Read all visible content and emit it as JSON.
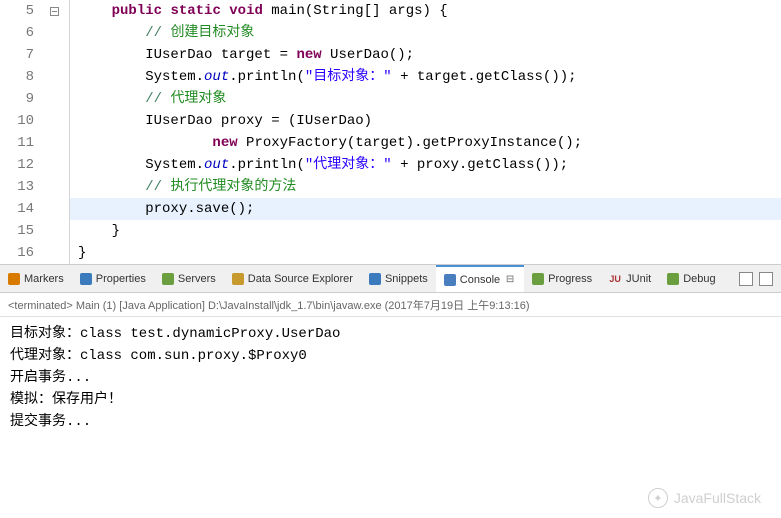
{
  "code": {
    "lines": [
      {
        "num": "5",
        "fold": true,
        "highlighted": false,
        "segments": [
          {
            "t": "    ",
            "c": "plain"
          },
          {
            "t": "public",
            "c": "kw"
          },
          {
            "t": " ",
            "c": "plain"
          },
          {
            "t": "static",
            "c": "kw"
          },
          {
            "t": " ",
            "c": "plain"
          },
          {
            "t": "void",
            "c": "kw"
          },
          {
            "t": " main(String[] args) {",
            "c": "plain"
          }
        ]
      },
      {
        "num": "6",
        "fold": false,
        "highlighted": false,
        "segments": [
          {
            "t": "        ",
            "c": "plain"
          },
          {
            "t": "// ",
            "c": "com"
          },
          {
            "t": "创建目标对象",
            "c": "com-cn"
          }
        ]
      },
      {
        "num": "7",
        "fold": false,
        "highlighted": false,
        "segments": [
          {
            "t": "        IUserDao target = ",
            "c": "plain"
          },
          {
            "t": "new",
            "c": "kw"
          },
          {
            "t": " UserDao();",
            "c": "plain"
          }
        ]
      },
      {
        "num": "8",
        "fold": false,
        "highlighted": false,
        "segments": [
          {
            "t": "        System.",
            "c": "plain"
          },
          {
            "t": "out",
            "c": "field"
          },
          {
            "t": ".println(",
            "c": "plain"
          },
          {
            "t": "\"目标对象：\"",
            "c": "str"
          },
          {
            "t": " + target.getClass());",
            "c": "plain"
          }
        ]
      },
      {
        "num": "9",
        "fold": false,
        "highlighted": false,
        "segments": [
          {
            "t": "        ",
            "c": "plain"
          },
          {
            "t": "// ",
            "c": "com"
          },
          {
            "t": "代理对象",
            "c": "com-cn"
          }
        ]
      },
      {
        "num": "10",
        "fold": false,
        "highlighted": false,
        "segments": [
          {
            "t": "        IUserDao proxy = (IUserDao)",
            "c": "plain"
          }
        ]
      },
      {
        "num": "11",
        "fold": false,
        "highlighted": false,
        "segments": [
          {
            "t": "                ",
            "c": "plain"
          },
          {
            "t": "new",
            "c": "kw"
          },
          {
            "t": " ProxyFactory(target).getProxyInstance();",
            "c": "plain"
          }
        ]
      },
      {
        "num": "12",
        "fold": false,
        "highlighted": false,
        "segments": [
          {
            "t": "        System.",
            "c": "plain"
          },
          {
            "t": "out",
            "c": "field"
          },
          {
            "t": ".println(",
            "c": "plain"
          },
          {
            "t": "\"代理对象：\"",
            "c": "str"
          },
          {
            "t": " + proxy.getClass());",
            "c": "plain"
          }
        ]
      },
      {
        "num": "13",
        "fold": false,
        "highlighted": false,
        "segments": [
          {
            "t": "        ",
            "c": "plain"
          },
          {
            "t": "// ",
            "c": "com"
          },
          {
            "t": "执行代理对象的方法",
            "c": "com-cn"
          }
        ]
      },
      {
        "num": "14",
        "fold": false,
        "highlighted": true,
        "segments": [
          {
            "t": "        proxy.save();",
            "c": "plain"
          }
        ]
      },
      {
        "num": "15",
        "fold": false,
        "highlighted": false,
        "segments": [
          {
            "t": "    }",
            "c": "plain"
          }
        ]
      },
      {
        "num": "16",
        "fold": false,
        "highlighted": false,
        "segments": [
          {
            "t": "}",
            "c": "plain"
          }
        ]
      }
    ]
  },
  "tabs": [
    {
      "id": "markers",
      "label": "Markers",
      "icon": "#d97a00"
    },
    {
      "id": "properties",
      "label": "Properties",
      "icon": "#3a7abd"
    },
    {
      "id": "servers",
      "label": "Servers",
      "icon": "#6a9e3f"
    },
    {
      "id": "dse",
      "label": "Data Source Explorer",
      "icon": "#c79a2e"
    },
    {
      "id": "snippets",
      "label": "Snippets",
      "icon": "#3a7abd"
    },
    {
      "id": "console",
      "label": "Console",
      "icon": "#4a7fbf",
      "active": true
    },
    {
      "id": "progress",
      "label": "Progress",
      "icon": "#6a9e3f"
    },
    {
      "id": "junit",
      "label": "JUnit",
      "icon": "#aa3333",
      "prefix": "JU"
    },
    {
      "id": "debug",
      "label": "Debug",
      "icon": "#6a9e3f"
    }
  ],
  "console": {
    "header": "<terminated> Main (1) [Java Application] D:\\JavaInstall\\jdk_1.7\\bin\\javaw.exe (2017年7月19日 上午9:13:16)",
    "lines": [
      "目标对象：class test.dynamicProxy.UserDao",
      "代理对象：class com.sun.proxy.$Proxy0",
      "开启事务...",
      "模拟：保存用户！",
      "提交事务..."
    ]
  },
  "watermark": "JavaFullStack"
}
